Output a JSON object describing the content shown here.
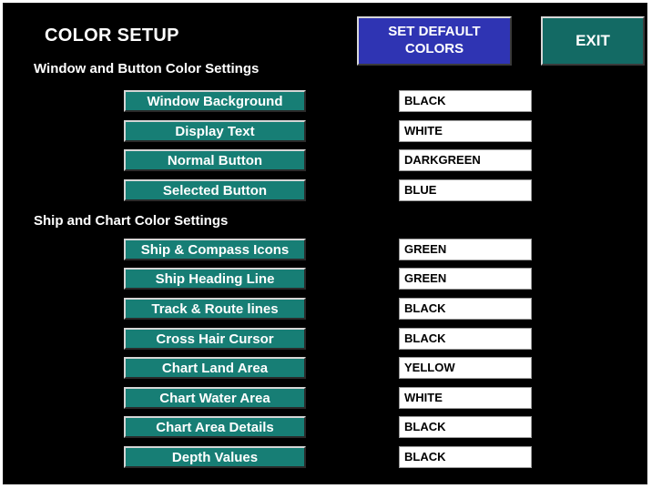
{
  "title": "COLOR SETUP",
  "buttons": {
    "set_default_line1": "SET DEFAULT",
    "set_default_line2": "COLORS",
    "exit": "EXIT"
  },
  "sections": {
    "window": "Window and Button Color Settings",
    "ship": "Ship and Chart Color Settings"
  },
  "window_settings": [
    {
      "label": "Window Background",
      "value": "BLACK"
    },
    {
      "label": "Display Text",
      "value": "WHITE"
    },
    {
      "label": "Normal Button",
      "value": "DARKGREEN"
    },
    {
      "label": "Selected Button",
      "value": "BLUE"
    }
  ],
  "ship_settings": [
    {
      "label": "Ship & Compass Icons",
      "value": "GREEN"
    },
    {
      "label": "Ship Heading Line",
      "value": "GREEN"
    },
    {
      "label": "Track & Route lines",
      "value": "BLACK"
    },
    {
      "label": "Cross Hair Cursor",
      "value": "BLACK"
    },
    {
      "label": "Chart Land Area",
      "value": "YELLOW"
    },
    {
      "label": "Chart Water Area",
      "value": "WHITE"
    },
    {
      "label": "Chart Area Details",
      "value": "BLACK"
    },
    {
      "label": "Depth Values",
      "value": "BLACK"
    }
  ],
  "colors": {
    "background": "#000000",
    "setting_button": "#177e75",
    "default_button": "#2f34b3",
    "exit_button": "#136a64",
    "field": "#ffffff"
  }
}
